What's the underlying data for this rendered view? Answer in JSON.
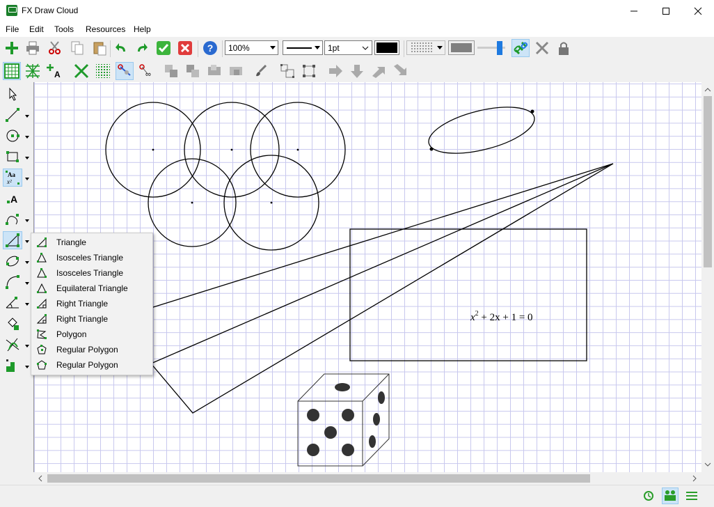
{
  "window": {
    "title": "FX Draw Cloud",
    "minimize_icon": "minimize-icon",
    "maximize_icon": "maximize-icon",
    "close_icon": "close-icon"
  },
  "menu": [
    "File",
    "Edit",
    "Tools",
    "Resources",
    "Help"
  ],
  "toolbar": {
    "zoom": "100%",
    "line_width": "1pt",
    "line_color": "#000000",
    "fill_pattern": "pattern",
    "fill_color": "#808080",
    "buttons": [
      "new-icon",
      "print-icon",
      "cut-icon",
      "copy-icon",
      "paste-icon",
      "undo-icon",
      "redo-icon",
      "ok-icon",
      "cancel-icon",
      "help-icon",
      "link-icon",
      "unlink-icon",
      "lock-icon"
    ]
  },
  "toolbar2": {
    "buttons": [
      "grid-icon",
      "iso-grid-icon",
      "snap-text-icon",
      "axes-icon",
      "dot-grid-icon",
      "snap-points-icon",
      "snap-intersect-icon",
      "group-icon",
      "ungroup-icon",
      "bring-front-icon",
      "send-back-icon",
      "brush-icon",
      "align-icon",
      "distribute-icon",
      "arrow-right-icon",
      "arrow-down-icon",
      "arrow-up-right-icon",
      "arrow-down-right-icon"
    ]
  },
  "tools": [
    "pointer-icon",
    "line-tool-icon",
    "circle-tool-icon",
    "rectangle-tool-icon",
    "text-math-tool-icon",
    "text-tool-icon",
    "curve-tool-icon",
    "polygon-tool-icon",
    "ellipse-tool-icon",
    "arc-tool-icon",
    "angle-tool-icon",
    "fill-tool-icon",
    "axes-tool-icon",
    "graph-tool-icon"
  ],
  "popup_menu": [
    {
      "label": "Triangle",
      "icon": "triangle-icon"
    },
    {
      "label": "Isosceles Triangle",
      "icon": "isosceles-triangle-icon"
    },
    {
      "label": "Isosceles Triangle",
      "icon": "isosceles-triangle-icon"
    },
    {
      "label": "Equilateral Triangle",
      "icon": "equilateral-triangle-icon"
    },
    {
      "label": "Right Triangle",
      "icon": "right-triangle-icon"
    },
    {
      "label": "Right Triangle",
      "icon": "right-triangle-icon"
    },
    {
      "label": "Polygon",
      "icon": "polygon-icon"
    },
    {
      "label": "Regular Polygon",
      "icon": "regular-polygon-icon"
    },
    {
      "label": "Regular Polygon",
      "icon": "regular-polygon-icon"
    }
  ],
  "canvas": {
    "equation_x": "x",
    "equation_exp": "2",
    "equation_rest": " + 2x + 1  =  0"
  },
  "status": {
    "icons": [
      "history-icon",
      "users-icon",
      "menu-icon"
    ],
    "accent": "#2a9d2a"
  }
}
